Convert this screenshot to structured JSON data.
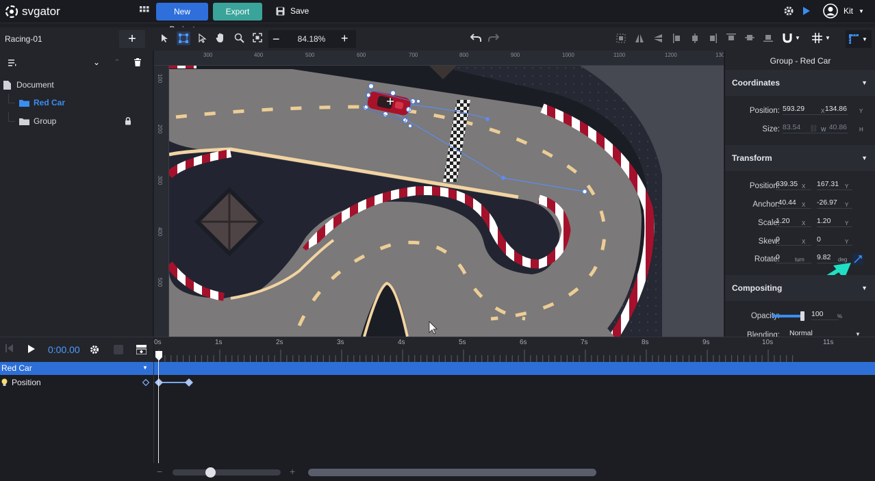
{
  "app": {
    "logo_text": "svgator",
    "new_project_label": "New Project",
    "export_label": "Export",
    "save_label": "Save",
    "user_name": "Kit"
  },
  "project": {
    "name": "Racing-01"
  },
  "toolbar": {
    "zoom": "84.18%"
  },
  "layers": [
    {
      "name": "Document"
    },
    {
      "name": "Red Car"
    },
    {
      "name": "Group"
    }
  ],
  "ruler": {
    "h_ticks": [
      "300",
      "400",
      "500",
      "600",
      "700",
      "800",
      "900",
      "1000",
      "1100",
      "1200",
      "130"
    ],
    "v_ticks": [
      "100",
      "200",
      "300",
      "400",
      "500"
    ]
  },
  "inspector": {
    "title": "Group - Red Car",
    "coordinates": {
      "header": "Coordinates",
      "position_label": "Position:",
      "position_x": "593.29",
      "x_unit": "X",
      "position_y": "134.86",
      "y_unit": "Y",
      "size_label": "Size:",
      "size_w": "83.54",
      "w_unit": "W",
      "size_h": "40.86",
      "h_unit": "H"
    },
    "transform": {
      "header": "Transform",
      "position_label": "Position:",
      "position_x": "639.35",
      "position_y": "167.31",
      "anchor_label": "Anchor:",
      "anchor_x": "-40.44",
      "anchor_y": "-26.97",
      "scale_label": "Scale:",
      "scale_x": "1.20",
      "scale_y": "1.20",
      "skew_label": "Skew:",
      "skew_x": "0",
      "skew_y": "0",
      "rotate_label": "Rotate:",
      "rotate_turn": "0",
      "turn_unit": "turn",
      "rotate_deg": "9.82",
      "deg_unit": "deg",
      "x_unit": "X",
      "y_unit": "Y"
    },
    "compositing": {
      "header": "Compositing",
      "opacity_label": "Opacity:",
      "opacity_value": "100",
      "opacity_unit": "%",
      "opacity_level": 1.0,
      "blending_label": "Blending:",
      "blending_value": "Normal"
    }
  },
  "timeline": {
    "time": "0:00.00",
    "seconds": [
      "0s",
      "1s",
      "2s",
      "3s",
      "4s",
      "5s",
      "6s",
      "7s",
      "8s",
      "9s",
      "10s",
      "11s"
    ],
    "track_name": "Red Car",
    "property_name": "Position"
  },
  "colors": {
    "accent_blue": "#2f6fdb",
    "export_teal": "#3aa39a",
    "selection_blue": "#2d6fd6",
    "arrow_cyan": "#1fe0c4",
    "kerb_red": "#a5112c"
  }
}
